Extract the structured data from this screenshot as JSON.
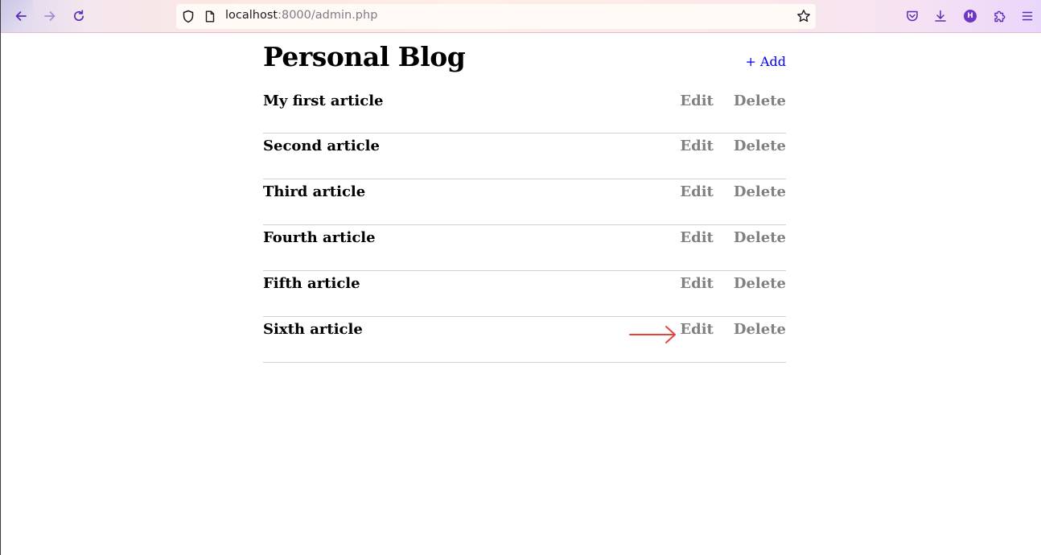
{
  "browser": {
    "url_host": "localhost",
    "url_rest": ":8000/admin.php",
    "profile_initial": "H"
  },
  "page": {
    "title": "Personal Blog",
    "add_label": "+ Add"
  },
  "articles": [
    {
      "title": "My first article",
      "edit": "Edit",
      "delete": "Delete"
    },
    {
      "title": "Second article",
      "edit": "Edit",
      "delete": "Delete"
    },
    {
      "title": "Third article",
      "edit": "Edit",
      "delete": "Delete"
    },
    {
      "title": "Fourth article",
      "edit": "Edit",
      "delete": "Delete"
    },
    {
      "title": "Fifth article",
      "edit": "Edit",
      "delete": "Delete"
    },
    {
      "title": "Sixth article",
      "edit": "Edit",
      "delete": "Delete"
    }
  ],
  "colors": {
    "link": "#0000ee",
    "action": "#808080",
    "annotation_arrow": "#e5463a",
    "divider": "#d0d0d0"
  },
  "annotation": {
    "icon": "arrow-right-icon",
    "points_to": "articles.5.edit"
  }
}
